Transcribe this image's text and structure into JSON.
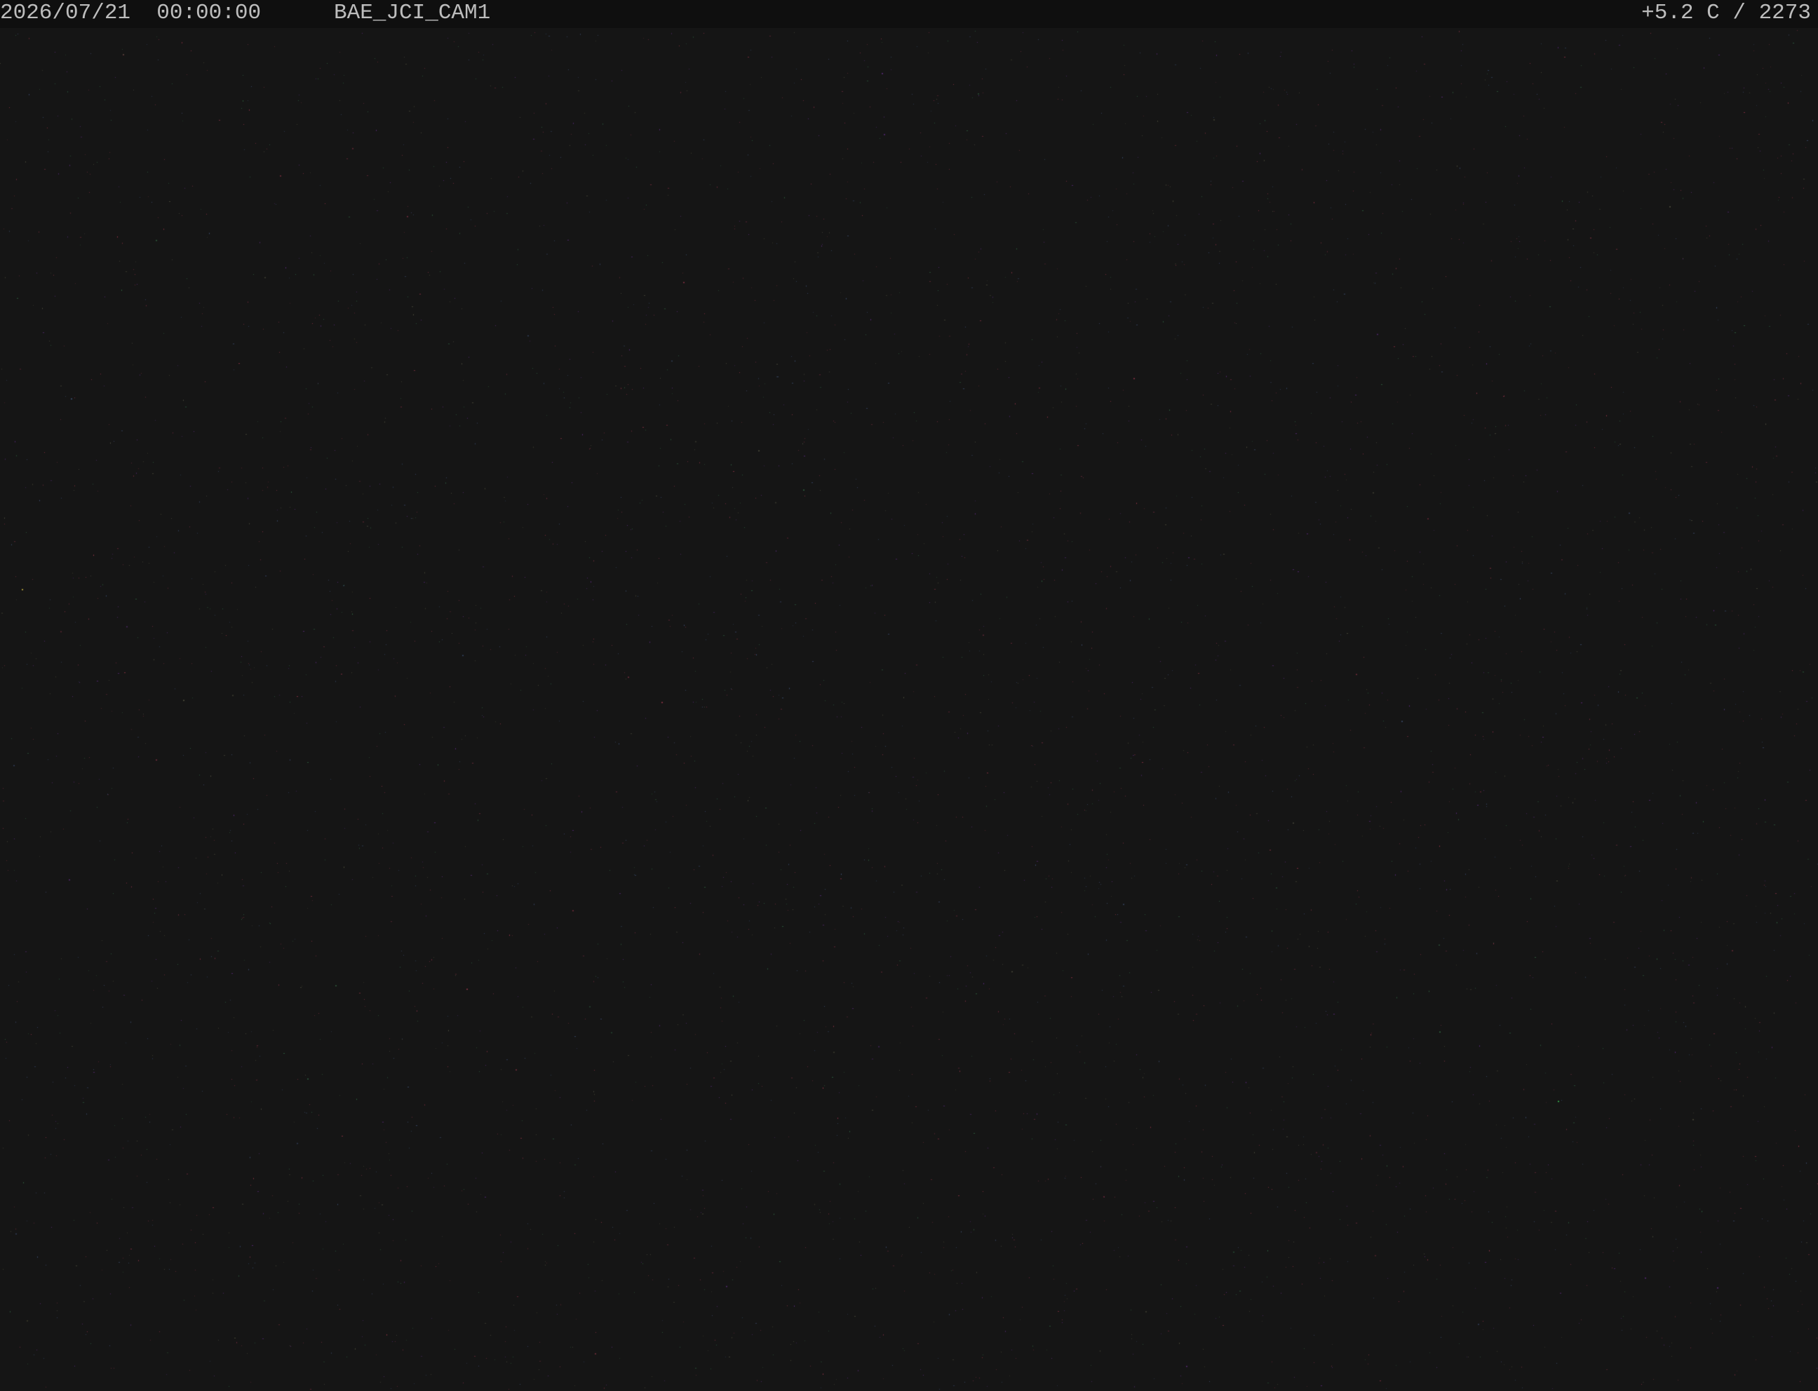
{
  "overlay": {
    "date": "2026/07/21",
    "time": "00:00:00",
    "camera_name": "BAE_JCI_CAM1",
    "temperature": "+5.2 C",
    "counter": "2273"
  },
  "colors": {
    "background": "#151515",
    "overlay_bar": "#0f0f0f",
    "overlay_text": "#bdbdbd",
    "pixel_noise": [
      "#8a3245",
      "#5a2a7a",
      "#3a4a6a",
      "#4a4a3a",
      "#6a2a3a",
      "#2f5f3f"
    ]
  }
}
